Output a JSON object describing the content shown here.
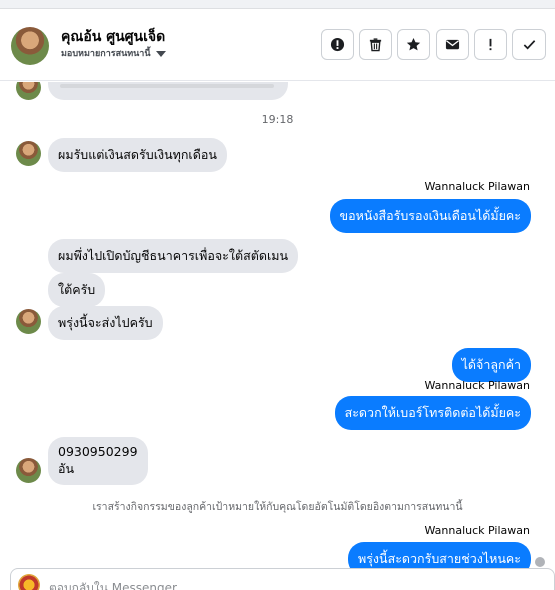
{
  "header": {
    "name": "คุณอ้น ศูนศูนเจ็ด",
    "subtitle": "มอบหมายการสนทนานี้"
  },
  "toolbar": {
    "buttons": [
      {
        "icon": "alert-circle-icon"
      },
      {
        "icon": "trash-icon"
      },
      {
        "icon": "star-icon"
      },
      {
        "icon": "envelope-icon"
      },
      {
        "icon": "exclamation-icon"
      },
      {
        "icon": "checkmark-icon"
      }
    ]
  },
  "chat": {
    "timestamp": "19:18",
    "messages": [
      {
        "text": "ผมรับแต่เงินสดรับเงินทุกเดือน"
      },
      {
        "sender": "Wannaluck Pilawan",
        "text": "ขอหนังสือรับรองเงินเดือนได้มั้ยคะ"
      },
      {
        "text": "ผมพึ่งไปเปิดบัญชีธนาคารเพื่อจะใต้สตัดเมน"
      },
      {
        "text": "ใต้ครับ"
      },
      {
        "text": "พรุ่งนี้จะส่งไปครับ"
      },
      {
        "text": "ได้จ้าลูกค้า"
      },
      {
        "sender": "Wannaluck Pilawan",
        "text": "สะดวกให้เบอร์โทรติดต่อได้มั้ยคะ"
      },
      {
        "line1": "0930950299",
        "line2": "อัน"
      },
      {
        "sender": "Wannaluck Pilawan",
        "text": "พรุ่งนี้สะดวกรับสายช่วงไหนคะ"
      }
    ],
    "notice": "เราสร้างกิจกรรมของลูกค้าเป้าหมายให้กับคุณโดยอัตโนมัติโดยอิงตามการสนทนานี้"
  },
  "composer": {
    "placeholder": "ตอบกลับใน Messenger"
  },
  "colors": {
    "outgoing_bubble": "#0a7cff",
    "incoming_bubble": "#e4e6eb"
  }
}
